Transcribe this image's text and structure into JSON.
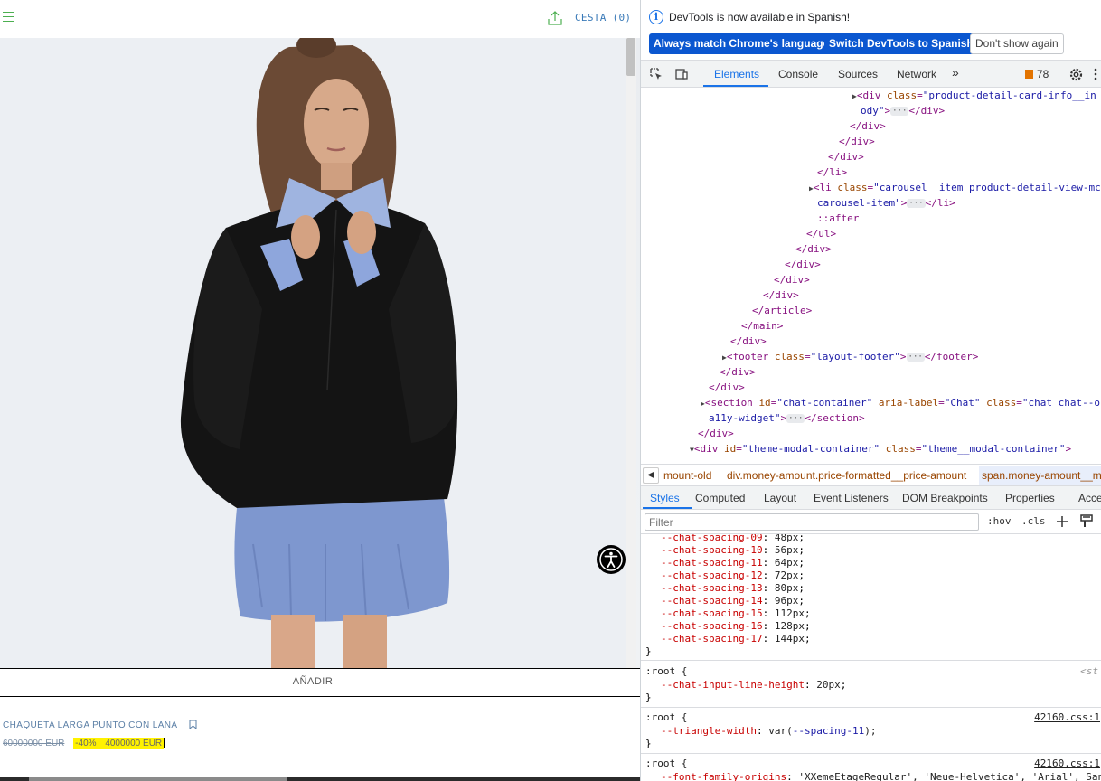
{
  "page": {
    "cart_label": "CESTA (0)",
    "add_button": "AÑADIR",
    "product_name": "CHAQUETA LARGA PUNTO CON LANA",
    "old_price": "60000000 EUR",
    "discount": "-40%",
    "new_price": "4000000 EUR"
  },
  "icons": {
    "menu": "menu-icon",
    "share": "share-icon",
    "bookmark": "bookmark-icon",
    "accessibility": "accessibility-icon"
  },
  "devtools": {
    "infobar": {
      "message": "DevTools is now available in Spanish!",
      "btn_match": "Always match Chrome's language",
      "btn_switch": "Switch DevTools to Spanish",
      "btn_dismiss": "Don't show again"
    },
    "tabs": [
      "Elements",
      "Console",
      "Sources",
      "Network"
    ],
    "more_tabs": "»",
    "issues_count": "78",
    "breadcrumbs": [
      "mount-old",
      "div.money-amount.price-formatted__price-amount",
      "span.money-amount__main"
    ],
    "styles_tabs": [
      "Styles",
      "Computed",
      "Layout",
      "Event Listeners",
      "DOM Breakpoints",
      "Properties",
      "Accessibility"
    ],
    "filter_placeholder": "Filter",
    "filter_hov": ":hov",
    "filter_cls": ".cls",
    "css_vars": [
      {
        "name": "--chat-spacing-09",
        "value": "48px"
      },
      {
        "name": "--chat-spacing-10",
        "value": "56px"
      },
      {
        "name": "--chat-spacing-11",
        "value": "64px"
      },
      {
        "name": "--chat-spacing-12",
        "value": "72px"
      },
      {
        "name": "--chat-spacing-13",
        "value": "80px"
      },
      {
        "name": "--chat-spacing-14",
        "value": "96px"
      },
      {
        "name": "--chat-spacing-15",
        "value": "112px"
      },
      {
        "name": "--chat-spacing-16",
        "value": "128px"
      },
      {
        "name": "--chat-spacing-17",
        "value": "144px"
      }
    ],
    "rule2": {
      "selector": ":root {",
      "prop": "--chat-input-line-height",
      "value": "20px",
      "source": "<st"
    },
    "rule3": {
      "selector": ":root {",
      "prop": "--triangle-width",
      "value_prefix": "var(",
      "value_var": "--spacing-11",
      "value_suffix": ");",
      "source": "42160.css:1"
    },
    "rule4": {
      "selector": ":root {",
      "prop": "--font-family-origins",
      "value": "'XXemeEtageRegular', 'Neue-Helvetica', 'Arial', San",
      "source": "42160.css:1"
    }
  }
}
